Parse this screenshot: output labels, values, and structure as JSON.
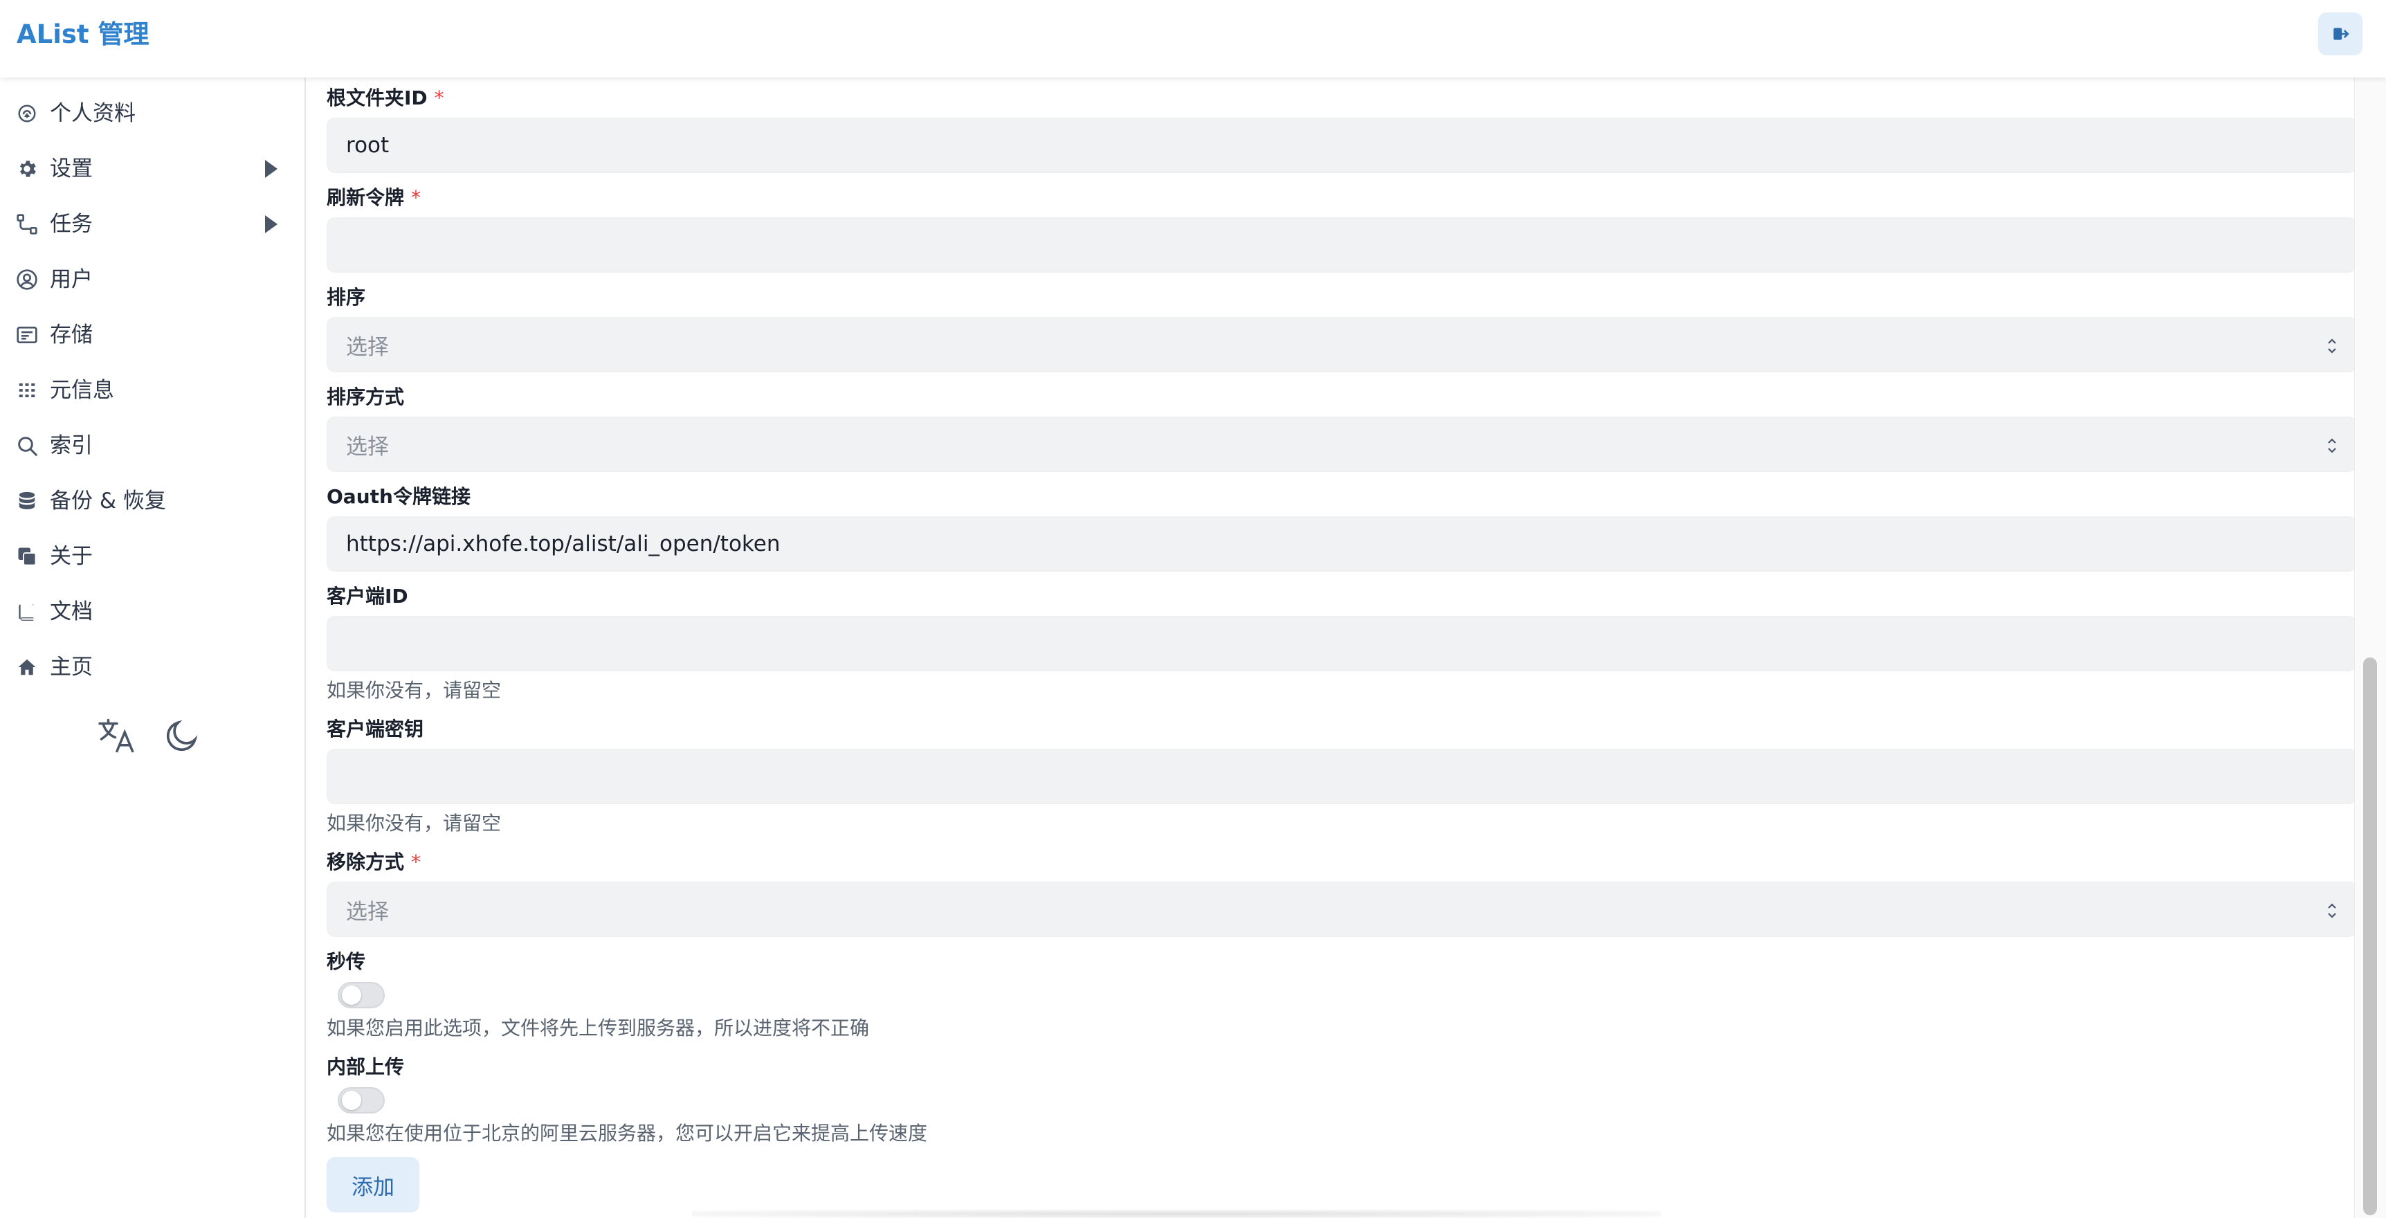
{
  "header": {
    "brand": "AList 管理",
    "logout_icon": "logout-icon"
  },
  "sidebar": {
    "items": [
      {
        "label": "个人资料",
        "icon": "fingerprint-icon"
      },
      {
        "label": "设置",
        "icon": "gear-icon",
        "expandable": true
      },
      {
        "label": "任务",
        "icon": "task-flow-icon",
        "expandable": true
      },
      {
        "label": "用户",
        "icon": "user-circle-icon"
      },
      {
        "label": "存储",
        "icon": "storage-icon"
      },
      {
        "label": "元信息",
        "icon": "meta-grid-icon"
      },
      {
        "label": "索引",
        "icon": "search-icon"
      },
      {
        "label": "备份 & 恢复",
        "icon": "database-icon"
      },
      {
        "label": "关于",
        "icon": "copy-icon"
      },
      {
        "label": "文档",
        "icon": "book-icon"
      },
      {
        "label": "主页",
        "icon": "home-icon"
      }
    ],
    "tools": {
      "language_icon": "translate-icon",
      "theme_icon": "moon-icon"
    }
  },
  "form": {
    "root_folder": {
      "label": "根文件夹ID",
      "required": "*",
      "value": "root"
    },
    "refresh_token": {
      "label": "刷新令牌",
      "required": "*",
      "value": ""
    },
    "order_by": {
      "label": "排序",
      "placeholder": "选择"
    },
    "order_direction": {
      "label": "排序方式",
      "placeholder": "选择"
    },
    "oauth_url": {
      "label": "Oauth令牌链接",
      "value": "https://api.xhofe.top/alist/ali_open/token"
    },
    "client_id": {
      "label": "客户端ID",
      "value": "",
      "helper": "如果你没有，请留空"
    },
    "client_secret": {
      "label": "客户端密钥",
      "value": "",
      "helper": "如果你没有，请留空"
    },
    "remove_way": {
      "label": "移除方式",
      "required": "*",
      "placeholder": "选择"
    },
    "rapid_upload": {
      "label": "秒传",
      "enabled": false,
      "helper": "如果您启用此选项，文件将先上传到服务器，所以进度将不正确"
    },
    "internal_upload": {
      "label": "内部上传",
      "enabled": false,
      "helper": "如果您在使用位于北京的阿里云服务器，您可以开启它来提高上传速度"
    },
    "submit_label": "添加"
  },
  "colors": {
    "accent": "#3182ce",
    "required": "#e53e3e",
    "field_bg": "#f1f2f4",
    "button_bg": "#e3eefb"
  }
}
